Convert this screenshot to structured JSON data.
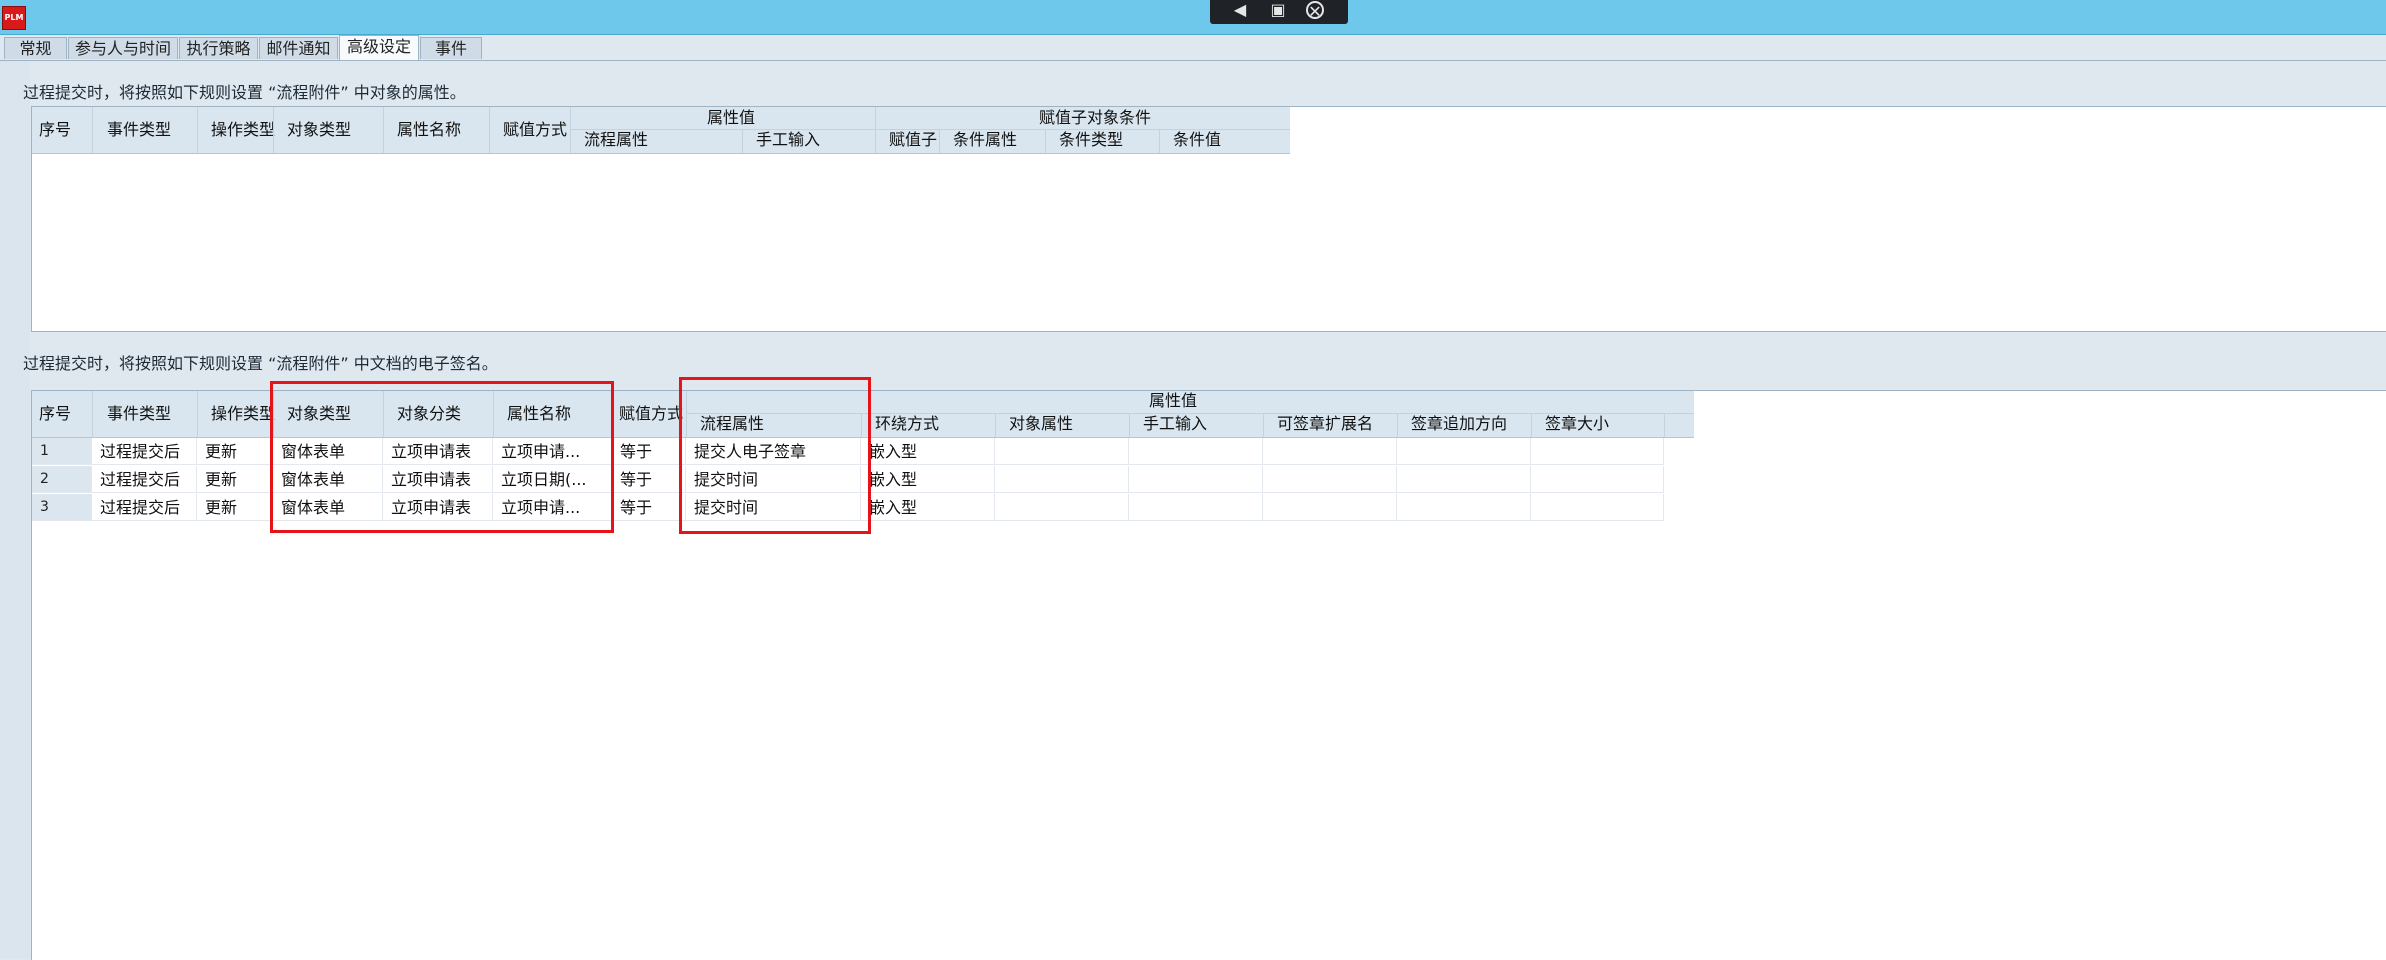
{
  "window": {
    "app_icon": "PLM"
  },
  "floating_toolbar": {
    "send_icon": "send-icon",
    "screen_icon": "screen-icon",
    "close_icon": "close-icon"
  },
  "tabs": [
    {
      "label": "常规"
    },
    {
      "label": "参与人与时间"
    },
    {
      "label": "执行策略"
    },
    {
      "label": "邮件通知"
    },
    {
      "label": "高级设定"
    },
    {
      "label": "事件"
    }
  ],
  "active_tab_index": 4,
  "section1": {
    "label": "过程提交时，将按照如下规则设置 “流程附件” 中对象的属性。",
    "headers": {
      "seq": "序号",
      "event_type": "事件类型",
      "op_type": "操作类型",
      "obj_type": "对象类型",
      "attr_name": "属性名称",
      "assign_mode": "赋值方式",
      "attr_value_group": "属性值",
      "flow_attr": "流程属性",
      "manual_input": "手工输入",
      "child_cond_group": "赋值子对象条件",
      "assign_child": "赋值子",
      "cond_attr": "条件属性",
      "cond_type": "条件类型",
      "cond_value": "条件值"
    },
    "rows": []
  },
  "section2": {
    "label": "过程提交时，将按照如下规则设置 “流程附件” 中文档的电子签名。",
    "headers": {
      "seq": "序号",
      "event_type": "事件类型",
      "op_type": "操作类型",
      "obj_type": "对象类型",
      "obj_class": "对象分类",
      "attr_name": "属性名称",
      "assign_mode": "赋值方式",
      "attr_value_group": "属性值",
      "flow_attr": "流程属性",
      "wrap_mode": "环绕方式",
      "obj_attr": "对象属性",
      "manual_input": "手工输入",
      "sign_ext": "可签章扩展名",
      "sign_direction": "签章追加方向",
      "sign_size": "签章大小"
    },
    "rows": [
      {
        "seq": "1",
        "event_type": "过程提交后",
        "op_type": "更新",
        "obj_type": "窗体表单",
        "obj_class": "立项申请表",
        "attr_name": "立项申请...",
        "assign_mode": "等于",
        "flow_attr": "提交人电子签章",
        "wrap_mode": "嵌入型",
        "obj_attr": "",
        "manual_input": "",
        "sign_ext": "",
        "sign_direction": "",
        "sign_size": ""
      },
      {
        "seq": "2",
        "event_type": "过程提交后",
        "op_type": "更新",
        "obj_type": "窗体表单",
        "obj_class": "立项申请表",
        "attr_name": "立项日期(...",
        "assign_mode": "等于",
        "flow_attr": "提交时间",
        "wrap_mode": "嵌入型",
        "obj_attr": "",
        "manual_input": "",
        "sign_ext": "",
        "sign_direction": "",
        "sign_size": ""
      },
      {
        "seq": "3",
        "event_type": "过程提交后",
        "op_type": "更新",
        "obj_type": "窗体表单",
        "obj_class": "立项申请表",
        "attr_name": "立项申请...",
        "assign_mode": "等于",
        "flow_attr": "提交时间",
        "wrap_mode": "嵌入型",
        "obj_attr": "",
        "manual_input": "",
        "sign_ext": "",
        "sign_direction": "",
        "sign_size": ""
      }
    ]
  },
  "colors": {
    "titlebar": "#6dc8ec",
    "highlight": "#e5141a",
    "header_bg": "#d9e6ef"
  }
}
